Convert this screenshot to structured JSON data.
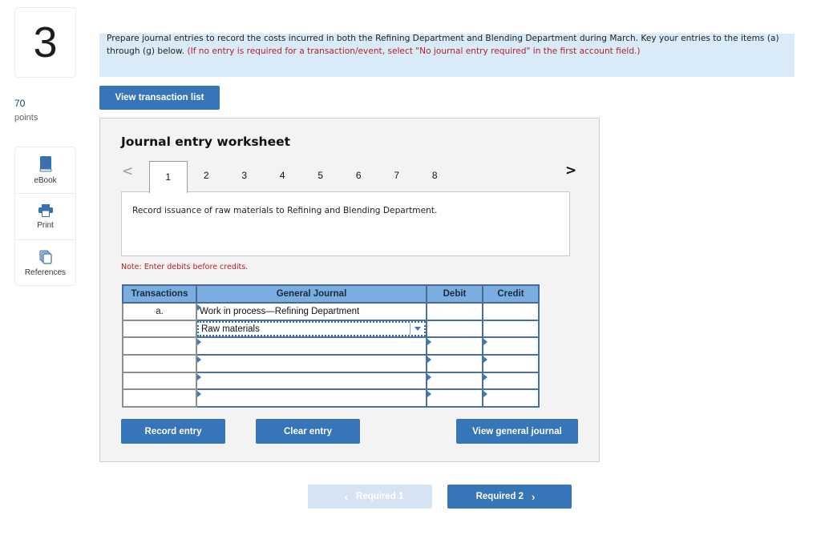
{
  "question": {
    "number": "3",
    "points_value": "70",
    "points_label": "points"
  },
  "tools": [
    {
      "label": "eBook",
      "icon": "book-icon"
    },
    {
      "label": "Print",
      "icon": "printer-icon"
    },
    {
      "label": "References",
      "icon": "documents-icon"
    }
  ],
  "instructions": {
    "main": "Prepare journal entries to record the costs incurred in both the Refining Department and Blending Department during March. Key your entries to the items (a) through (g) below.",
    "note": "(If no entry is required for a transaction/event, select \"No journal entry required\" in the first account field.)"
  },
  "buttons": {
    "view_transaction_list": "View transaction list",
    "record_entry": "Record entry",
    "clear_entry": "Clear entry",
    "view_general_journal": "View general journal",
    "required_1": "Required 1",
    "required_2": "Required 2"
  },
  "worksheet": {
    "title": "Journal entry worksheet",
    "prev": "<",
    "next": ">",
    "tabs": [
      "1",
      "2",
      "3",
      "4",
      "5",
      "6",
      "7",
      "8"
    ],
    "active_tab": "1",
    "description": "Record issuance of raw materials to Refining and Blending Department.",
    "note": "Note: Enter debits before credits.",
    "table": {
      "headers": [
        "Transactions",
        "General Journal",
        "Debit",
        "Credit"
      ],
      "rows": [
        {
          "transaction": "a.",
          "account": "Work in process—Refining Department",
          "debit": "",
          "credit": ""
        },
        {
          "transaction": "",
          "account": "Raw materials",
          "debit": "",
          "credit": ""
        },
        {
          "transaction": "",
          "account": "",
          "debit": "",
          "credit": ""
        },
        {
          "transaction": "",
          "account": "",
          "debit": "",
          "credit": ""
        },
        {
          "transaction": "",
          "account": "",
          "debit": "",
          "credit": ""
        },
        {
          "transaction": "",
          "account": "",
          "debit": "",
          "credit": ""
        }
      ]
    }
  },
  "colors": {
    "accent": "#3675b8",
    "banner_bg": "#d9ebf9",
    "note_red": "#b2202a",
    "table_header": "#7aaee3",
    "disabled_button": "#d6e3f2"
  }
}
